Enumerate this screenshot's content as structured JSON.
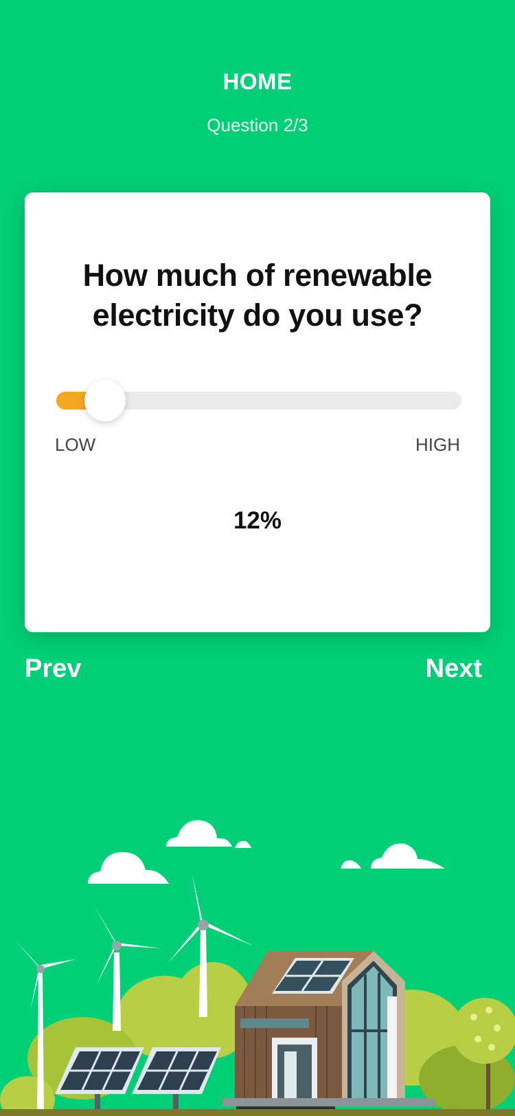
{
  "header": {
    "title": "HOME",
    "subtitle": "Question 2/3"
  },
  "card": {
    "question": "How much of renewable electricity do you use?",
    "slider": {
      "min_label": "LOW",
      "max_label": "HIGH",
      "value_percent": 12,
      "value_text": "12%"
    }
  },
  "nav": {
    "prev_label": "Prev",
    "next_label": "Next"
  },
  "colors": {
    "background": "#00cf77",
    "slider_fill": "#f5a623",
    "slider_track": "#ebebeb"
  }
}
